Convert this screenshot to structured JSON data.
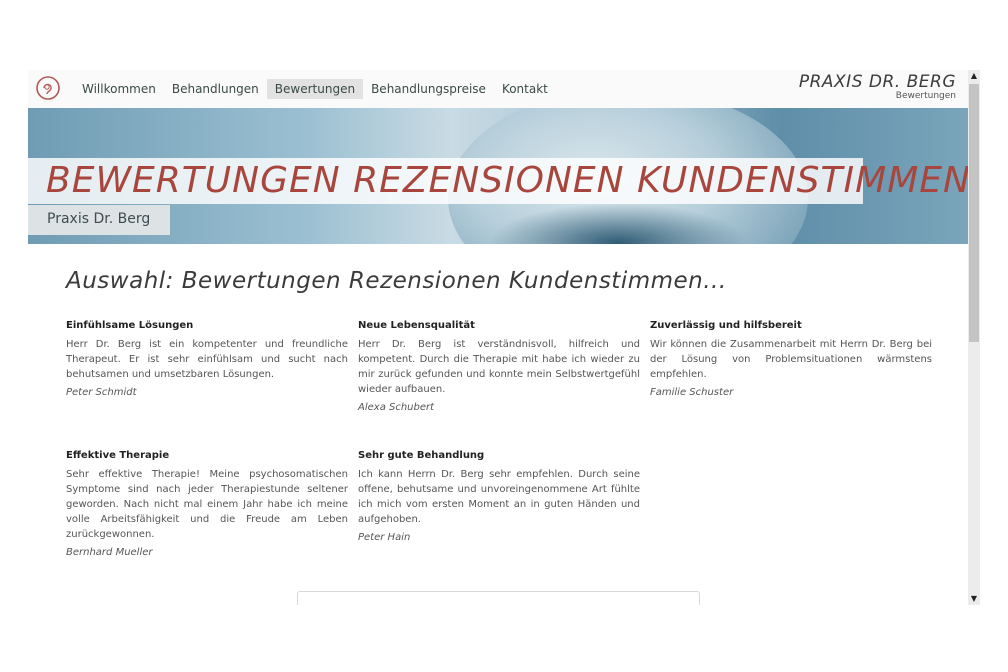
{
  "nav": {
    "items": [
      "Willkommen",
      "Behandlungen",
      "Bewertungen",
      "Behandlungspreise",
      "Kontakt"
    ],
    "active": "Bewertungen"
  },
  "brand": {
    "title": "PRAXIS DR. BERG",
    "subtitle": "Bewertungen"
  },
  "hero": {
    "title": "BEWERTUNGEN REZENSIONEN KUNDENSTIMMEN",
    "subtitle": "Praxis Dr. Berg"
  },
  "main": {
    "heading": "Auswahl: Bewertungen Rezensionen Kundenstimmen...",
    "reviews": [
      {
        "title": "Einfühlsame Lösungen",
        "text": "Herr Dr. Berg ist ein kompetenter und freundliche Therapeut. Er ist sehr einfühlsam und sucht nach behutsamen und umsetzbaren Lösungen.",
        "author": "Peter Schmidt"
      },
      {
        "title": "Neue Lebensqualität",
        "text": "Herr Dr. Berg ist verständnisvoll, hilfreich und kompetent. Durch die Therapie mit habe ich wieder zu mir zurück gefunden und konnte mein Selbstwertgefühl wieder aufbauen.",
        "author": "Alexa Schubert"
      },
      {
        "title": "Zuverlässig und hilfsbereit",
        "text": "Wir können die Zusammenarbeit mit Herrn Dr. Berg bei der Lösung von Problemsituationen wärmstens empfehlen.",
        "author": "Familie Schuster"
      },
      {
        "title": "Effektive Therapie",
        "text": "Sehr effektive Therapie! Meine psychosomatischen Symptome sind nach jeder Therapiestunde seltener geworden. Nach nicht mal einem Jahr habe ich meine volle Arbeitsfähigkeit und die Freude am Leben zurückgewonnen.",
        "author": "Bernhard Mueller"
      },
      {
        "title": "Sehr gute Behandlung",
        "text": "Ich kann Herrn Dr. Berg sehr empfehlen. Durch seine offene, behutsame und unvoreingenommene Art fühlte ich mich vom ersten Moment an in guten Händen und aufgehoben.",
        "author": "Peter Hain"
      }
    ]
  },
  "colors": {
    "accent": "#a8463e",
    "nav_active_bg": "#e2e2e2",
    "hero_blue": "#6f9cb4"
  },
  "icons": {
    "logo": "head-outline-icon",
    "scroll_up": "arrow-up-icon",
    "scroll_down": "arrow-down-icon"
  }
}
